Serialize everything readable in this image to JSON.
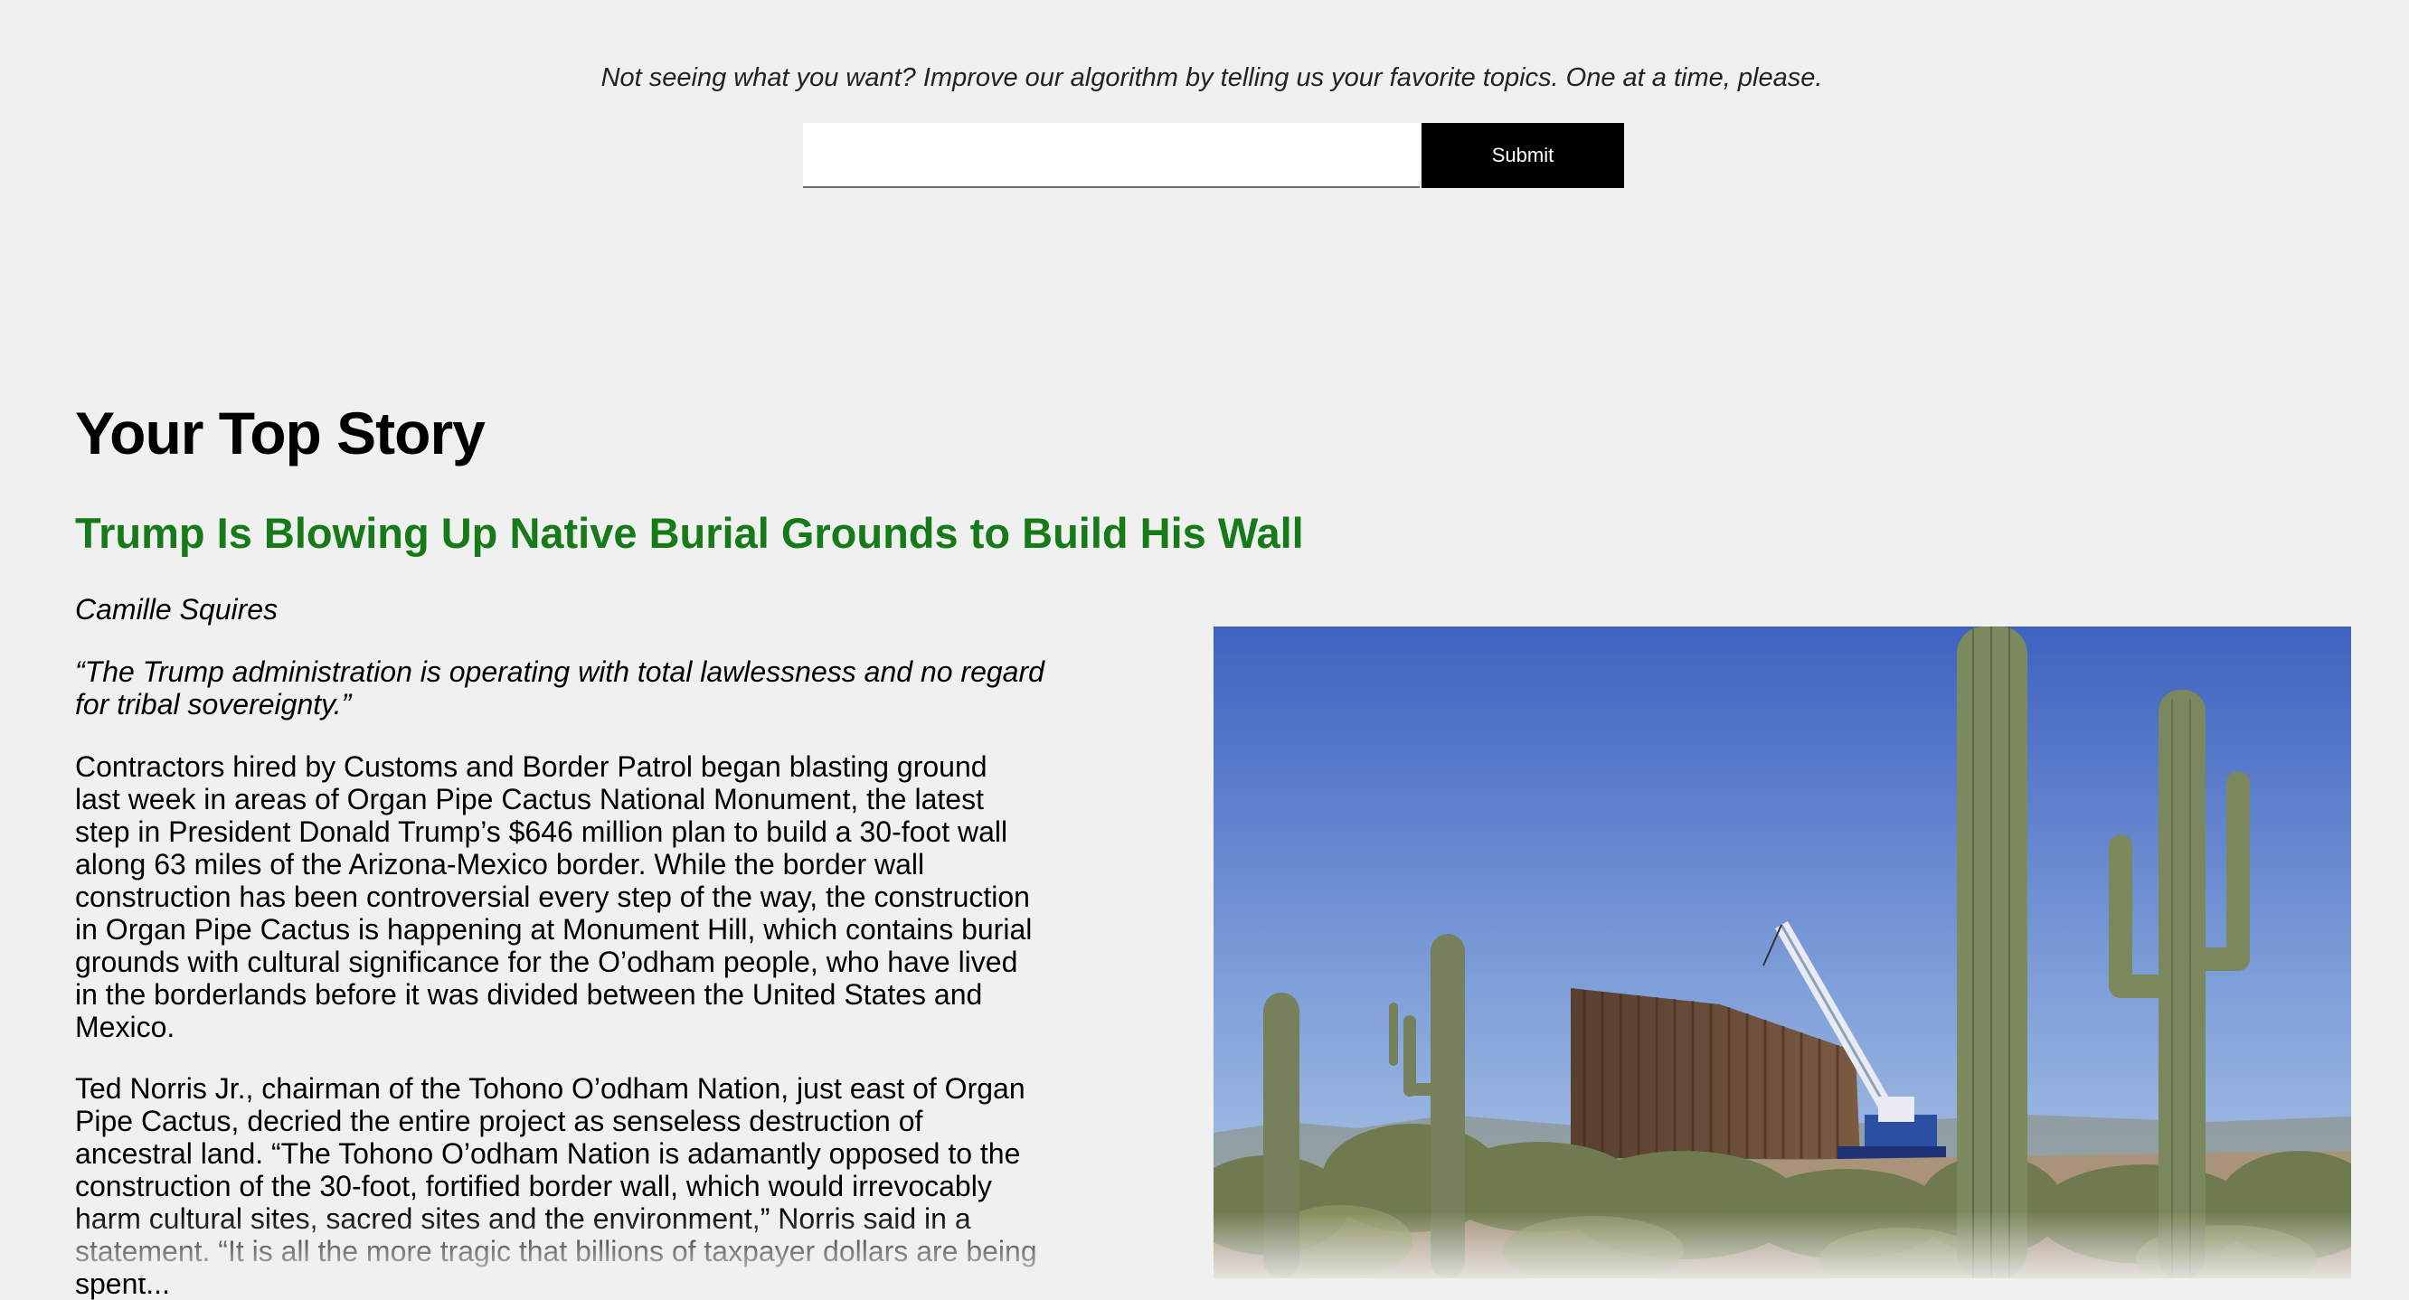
{
  "topics": {
    "prompt": "Not seeing what you want? Improve our algorithm by telling us your favorite topics. One at a time, please.",
    "input_value": "",
    "input_placeholder": "",
    "submit_label": "Submit"
  },
  "story": {
    "section_heading": "Your Top Story",
    "headline": "Trump Is Blowing Up Native Burial Grounds to Build His Wall",
    "author": "Camille Squires",
    "pullquote": "“The Trump administration is operating with total lawlessness and no regard for tribal sovereignty.”",
    "paragraphs": [
      "Contractors hired by Customs and Border Patrol began blasting ground last week in areas of Organ Pipe Cactus National Monument, the latest step in President Donald Trump’s $646 million plan to build a 30-foot wall along 63 miles of the Arizona-Mexico border. While the border wall construction has been controversial every step of the way, the construction in Organ Pipe Cactus is happening at Monument Hill, which contains burial grounds with cultural significance for the O’odham people, who have lived in the borderlands before it was divided between the United States and Mexico.",
      "Ted Norris Jr., chairman of the Tohono O’odham Nation, just east of Organ Pipe Cactus, decried the entire project as senseless destruction of ancestral land. “The Tohono O’odham Nation is adamantly opposed to the construction of the 30-foot, fortified border wall, which would irrevocably harm cultural sites, sacred sites and the environment,” Norris said in a statement. “It is all the more tragic that billions of taxpayer dollars are being spent..."
    ]
  },
  "photo": {
    "subject": "saguaro cacti in front of border wall construction with a crane",
    "colors": {
      "sky_top": "#3f66c4",
      "sky_bottom": "#a9c3e8",
      "cactus": "#7d8a5f",
      "ground": "#b39d7f",
      "wall": "#6b4a36"
    }
  },
  "colors": {
    "background": "#f0f0f0",
    "headline": "#157a17",
    "button": "#000000"
  }
}
